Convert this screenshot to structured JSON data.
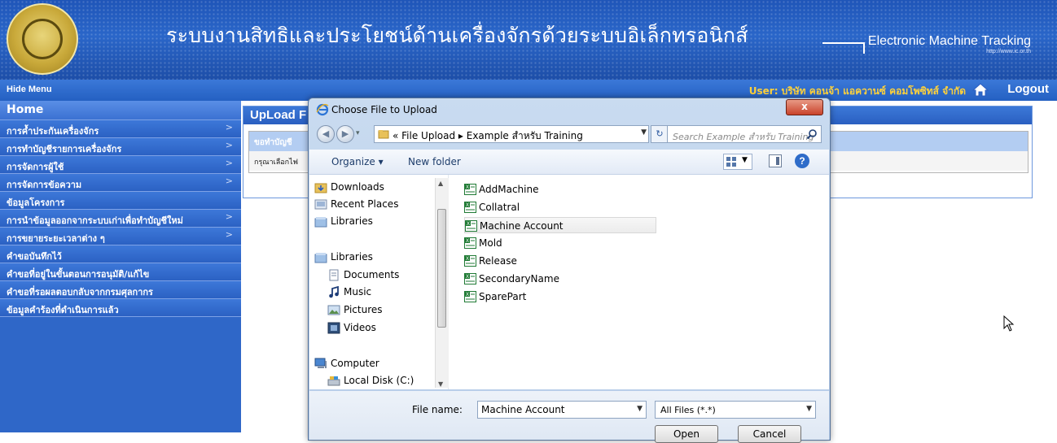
{
  "banner": {
    "title": "ระบบงานสิทธิและประโยชน์ด้านเครื่องจักรด้วยระบบอิเล็กทรอนิกส์",
    "brand": "Electronic Machine Tracking",
    "brand_url": "http://www.ic.or.th"
  },
  "topbar": {
    "hide_menu": "Hide Menu",
    "user": "User: บริษัท คอนจ้า แอควานซ์ คอมโพซิทส์ จำกัด",
    "logout": "Logout"
  },
  "sidebar": {
    "items": [
      {
        "label": "Home",
        "arrow": ""
      },
      {
        "label": "การค้ำประกันเครื่องจักร",
        "arrow": ">"
      },
      {
        "label": "การทำบัญชีรายการเครื่องจักร",
        "arrow": ">"
      },
      {
        "label": "การจัดการผู้ใช้",
        "arrow": ">"
      },
      {
        "label": "การจัดการข้อความ",
        "arrow": ">"
      },
      {
        "label": "ข้อมูลโครงการ",
        "arrow": ""
      },
      {
        "label": "การนำข้อมูลออกจากระบบเก่าเพื่อทำบัญชีใหม่",
        "arrow": ">"
      },
      {
        "label": "การขยายระยะเวลาต่าง ๆ",
        "arrow": ">"
      },
      {
        "label": "คำขอบันทึกไว้",
        "arrow": ""
      },
      {
        "label": "คำขอที่อยู่ในขั้นตอนการอนุมัติ/แก้ไข",
        "arrow": ""
      },
      {
        "label": "คำขอที่รอผลตอบกลับจากกรมศุลกากร",
        "arrow": ""
      },
      {
        "label": "ข้อมูลคำร้องที่ดำเนินการแล้ว",
        "arrow": ""
      }
    ]
  },
  "panel": {
    "title": "UpLoad F",
    "row1": "ขอทำบัญชี",
    "row2": "กรุณาเลือกไฟ"
  },
  "dialog": {
    "title": "Choose File to Upload",
    "close": "x",
    "address": "« File Upload ▸ Example สำหรับ Training",
    "search_placeholder": "Search Example สำหรับ Training",
    "organize": "Organize ▾",
    "new_folder": "New folder",
    "help": "?",
    "nav_items": [
      {
        "label": "Downloads",
        "icon": "downloads-folder-icon"
      },
      {
        "label": "Recent Places",
        "icon": "recent-places-icon"
      },
      {
        "label": "Libraries",
        "icon": "libraries-icon"
      },
      {
        "label": "Libraries",
        "icon": "libraries-icon"
      },
      {
        "label": "Documents",
        "icon": "documents-icon"
      },
      {
        "label": "Music",
        "icon": "music-icon"
      },
      {
        "label": "Pictures",
        "icon": "pictures-icon"
      },
      {
        "label": "Videos",
        "icon": "videos-icon"
      },
      {
        "label": "Computer",
        "icon": "computer-icon"
      },
      {
        "label": "Local Disk (C:)",
        "icon": "local-disk-icon"
      }
    ],
    "files": [
      {
        "name": "AddMachine",
        "selected": false
      },
      {
        "name": "Collatral",
        "selected": false
      },
      {
        "name": "Machine Account",
        "selected": true
      },
      {
        "name": "Mold",
        "selected": false
      },
      {
        "name": "Release",
        "selected": false
      },
      {
        "name": "SecondaryName",
        "selected": false
      },
      {
        "name": "SparePart",
        "selected": false
      }
    ],
    "file_name_label": "File name:",
    "file_name_value": "Machine Account",
    "file_type": "All Files (*.*)",
    "open_label": "Open",
    "cancel_label": "Cancel"
  },
  "colors": {
    "header_blue": "#2a66c9",
    "sidebar_blue": "#2f67c8",
    "user_text": "#ffd23a",
    "excel_green": "#1f7a34"
  }
}
